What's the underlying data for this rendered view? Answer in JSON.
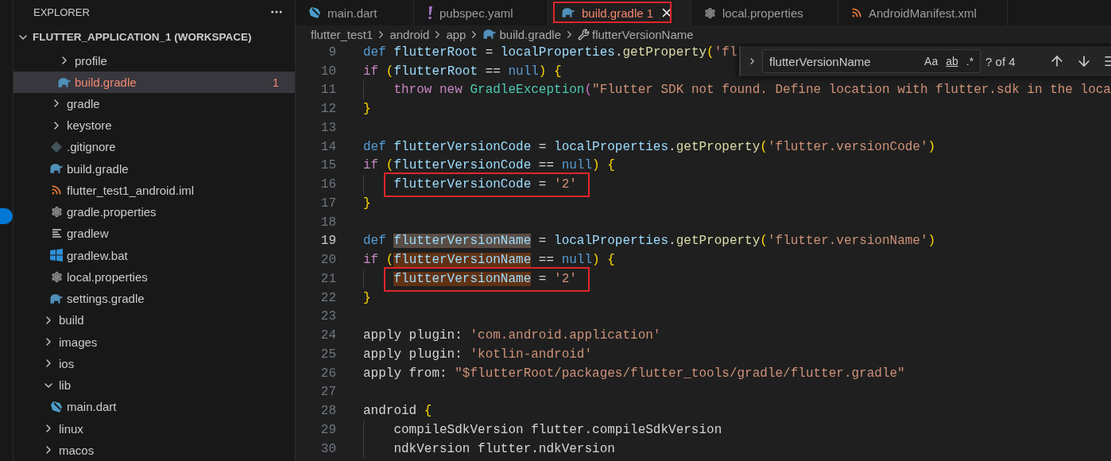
{
  "sidebar": {
    "title": "EXPLORER",
    "workspace": {
      "label": "FLUTTER_APPLICATION_1 (WORKSPACE)",
      "expanded": true,
      "children": [
        {
          "kind": "group",
          "children": [
            {
              "kind": "group",
              "children": [
                {
                  "kind": "folder",
                  "label": "profile",
                  "expanded": false,
                  "selected": false
                },
                {
                  "kind": "gradle",
                  "label": "build.gradle",
                  "selected": true,
                  "error": true,
                  "badge": "1"
                }
              ]
            },
            {
              "kind": "folder",
              "label": "gradle",
              "expanded": false,
              "selected": false
            },
            {
              "kind": "folder",
              "label": "keystore",
              "expanded": false,
              "selected": false
            },
            {
              "kind": "git",
              "label": ".gitignore",
              "selected": false,
              "error": false
            },
            {
              "kind": "gradle",
              "label": "build.gradle",
              "selected": false,
              "error": false
            },
            {
              "kind": "rss",
              "label": "flutter_test1_android.iml",
              "selected": false,
              "error": false
            },
            {
              "kind": "gear",
              "label": "gradle.properties",
              "selected": false,
              "error": false
            },
            {
              "kind": "lines",
              "label": "gradlew",
              "selected": false,
              "error": false
            },
            {
              "kind": "windows",
              "label": "gradlew.bat",
              "selected": false,
              "error": false
            },
            {
              "kind": "gear",
              "label": "local.properties",
              "selected": false,
              "error": false
            },
            {
              "kind": "gradle",
              "label": "settings.gradle",
              "selected": false,
              "error": false
            }
          ]
        },
        {
          "kind": "folder",
          "label": "build",
          "expanded": false,
          "selected": false
        },
        {
          "kind": "folder",
          "label": "images",
          "expanded": false,
          "selected": false
        },
        {
          "kind": "folder",
          "label": "ios",
          "expanded": false,
          "selected": false
        },
        {
          "kind": "folder",
          "label": "lib",
          "expanded": true,
          "selected": false,
          "children": [
            {
              "kind": "dart",
              "label": "main.dart",
              "selected": false,
              "error": false
            }
          ]
        },
        {
          "kind": "folder",
          "label": "linux",
          "expanded": false,
          "selected": false
        },
        {
          "kind": "folder",
          "label": "macos",
          "expanded": false,
          "selected": false
        }
      ]
    }
  },
  "tabs": [
    {
      "kind": "dart",
      "label": "main.dart",
      "selected": false,
      "error": false,
      "annotated": false
    },
    {
      "kind": "exclaim",
      "label": "pubspec.yaml",
      "selected": false,
      "error": false,
      "annotated": false
    },
    {
      "kind": "gradle",
      "label": "build.gradle",
      "selected": true,
      "error": true,
      "badge": "1",
      "annotated": true
    },
    {
      "kind": "gear",
      "label": "local.properties",
      "selected": false,
      "error": false,
      "annotated": false
    },
    {
      "kind": "rss",
      "label": "AndroidManifest.xml",
      "selected": false,
      "error": false,
      "annotated": false
    }
  ],
  "breadcrumb": [
    {
      "kind": "plain",
      "label": "flutter_test1"
    },
    {
      "kind": "plain",
      "label": "android"
    },
    {
      "kind": "plain",
      "label": "app"
    },
    {
      "kind": "gradle",
      "label": "build.gradle"
    },
    {
      "kind": "wrench",
      "label": "flutterVersionName"
    }
  ],
  "find": {
    "value": "flutterVersionName",
    "options": [
      "Aa",
      "ab",
      ".*"
    ],
    "result": "? of 4"
  },
  "code": [
    {
      "number": "9",
      "current": false,
      "indent": false,
      "tokens": [
        {
          "text": "def ",
          "kind": "kw"
        },
        {
          "text": "flutterRoot",
          "kind": "var"
        },
        {
          "text": " = ",
          "kind": "plain"
        },
        {
          "text": "localProperties",
          "kind": "var"
        },
        {
          "text": ".",
          "kind": "plain"
        },
        {
          "text": "getProperty",
          "kind": "fn"
        },
        {
          "text": "(",
          "kind": "br"
        },
        {
          "text": "'fl",
          "kind": "str"
        }
      ]
    },
    {
      "number": "10",
      "current": false,
      "indent": false,
      "tokens": [
        {
          "text": "if ",
          "kind": "ctl"
        },
        {
          "text": "(",
          "kind": "br"
        },
        {
          "text": "flutterRoot",
          "kind": "var"
        },
        {
          "text": " == ",
          "kind": "plain"
        },
        {
          "text": "null",
          "kind": "kw"
        },
        {
          "text": ")",
          "kind": "br"
        },
        {
          "text": " {",
          "kind": "br"
        }
      ]
    },
    {
      "number": "11",
      "current": false,
      "indent": true,
      "tokens": [
        {
          "text": "throw ",
          "kind": "ctl"
        },
        {
          "text": "new ",
          "kind": "ctl"
        },
        {
          "text": "GradleException",
          "kind": "type"
        },
        {
          "text": "(",
          "kind": "br2"
        },
        {
          "text": "\"Flutter SDK not found. Define location with flutter.sdk in the loca",
          "kind": "str"
        }
      ]
    },
    {
      "number": "12",
      "current": false,
      "indent": false,
      "tokens": [
        {
          "text": "}",
          "kind": "br"
        }
      ]
    },
    {
      "number": "13",
      "current": false
    },
    {
      "number": "14",
      "current": false,
      "indent": false,
      "tokens": [
        {
          "text": "def ",
          "kind": "kw"
        },
        {
          "text": "flutterVersionCode",
          "kind": "var"
        },
        {
          "text": " = ",
          "kind": "plain"
        },
        {
          "text": "localProperties",
          "kind": "var"
        },
        {
          "text": ".",
          "kind": "plain"
        },
        {
          "text": "getProperty",
          "kind": "fn"
        },
        {
          "text": "(",
          "kind": "br"
        },
        {
          "text": "'flutter.versionCode'",
          "kind": "str"
        },
        {
          "text": ")",
          "kind": "br"
        }
      ]
    },
    {
      "number": "15",
      "current": false,
      "indent": false,
      "tokens": [
        {
          "text": "if ",
          "kind": "ctl"
        },
        {
          "text": "(",
          "kind": "br"
        },
        {
          "text": "flutterVersionCode",
          "kind": "var"
        },
        {
          "text": " == ",
          "kind": "plain"
        },
        {
          "text": "null",
          "kind": "kw"
        },
        {
          "text": ")",
          "kind": "br"
        },
        {
          "text": " {",
          "kind": "br"
        }
      ]
    },
    {
      "number": "16",
      "current": false,
      "indent": true,
      "annotated": true,
      "tokens": [
        {
          "text": "flutterVersionCode",
          "kind": "var"
        },
        {
          "text": " = ",
          "kind": "plain"
        },
        {
          "text": "'2'",
          "kind": "str"
        }
      ]
    },
    {
      "number": "17",
      "current": false,
      "indent": false,
      "tokens": [
        {
          "text": "}",
          "kind": "br"
        }
      ]
    },
    {
      "number": "18",
      "current": false
    },
    {
      "number": "19",
      "current": true,
      "indent": false,
      "tokens": [
        {
          "text": "def ",
          "kind": "kw"
        },
        {
          "text": "flutterVersionName",
          "kind": "var",
          "highlighted": true,
          "active": true
        },
        {
          "text": " = ",
          "kind": "plain"
        },
        {
          "text": "localProperties",
          "kind": "var"
        },
        {
          "text": ".",
          "kind": "plain"
        },
        {
          "text": "getProperty",
          "kind": "fn"
        },
        {
          "text": "(",
          "kind": "br"
        },
        {
          "text": "'flutter.versionName'",
          "kind": "str"
        },
        {
          "text": ")",
          "kind": "br"
        }
      ]
    },
    {
      "number": "20",
      "current": false,
      "indent": false,
      "tokens": [
        {
          "text": "if ",
          "kind": "ctl"
        },
        {
          "text": "(",
          "kind": "br"
        },
        {
          "text": "flutterVersionName",
          "kind": "var",
          "highlighted": true,
          "active": false
        },
        {
          "text": " == ",
          "kind": "plain"
        },
        {
          "text": "null",
          "kind": "kw"
        },
        {
          "text": ")",
          "kind": "br"
        },
        {
          "text": " {",
          "kind": "br"
        }
      ]
    },
    {
      "number": "21",
      "current": false,
      "indent": true,
      "annotated": true,
      "tokens": [
        {
          "text": "flutterVersionName",
          "kind": "var",
          "highlighted": true,
          "active": false
        },
        {
          "text": " = ",
          "kind": "plain"
        },
        {
          "text": "'2'",
          "kind": "str"
        }
      ]
    },
    {
      "number": "22",
      "current": false,
      "indent": false,
      "tokens": [
        {
          "text": "}",
          "kind": "br"
        }
      ]
    },
    {
      "number": "23",
      "current": false
    },
    {
      "number": "24",
      "current": false,
      "indent": false,
      "tokens": [
        {
          "text": "apply plugin: ",
          "kind": "plain"
        },
        {
          "text": "'com.android.application'",
          "kind": "str"
        }
      ]
    },
    {
      "number": "25",
      "current": false,
      "indent": false,
      "tokens": [
        {
          "text": "apply plugin: ",
          "kind": "plain"
        },
        {
          "text": "'kotlin-android'",
          "kind": "str"
        }
      ]
    },
    {
      "number": "26",
      "current": false,
      "indent": false,
      "tokens": [
        {
          "text": "apply from: ",
          "kind": "plain"
        },
        {
          "text": "\"$flutterRoot/packages/flutter_tools/gradle/flutter.gradle\"",
          "kind": "str"
        }
      ]
    },
    {
      "number": "27",
      "current": false
    },
    {
      "number": "28",
      "current": false,
      "indent": false,
      "tokens": [
        {
          "text": "android ",
          "kind": "plain"
        },
        {
          "text": "{",
          "kind": "br"
        }
      ]
    },
    {
      "number": "29",
      "current": false,
      "indent": true,
      "tokens": [
        {
          "text": "compileSdkVersion flutter.compileSdkVersion",
          "kind": "plain"
        }
      ]
    },
    {
      "number": "30",
      "current": false,
      "indent": true,
      "tokens": [
        {
          "text": "ndkVersion flutter.ndkVersion",
          "kind": "plain"
        }
      ]
    }
  ]
}
